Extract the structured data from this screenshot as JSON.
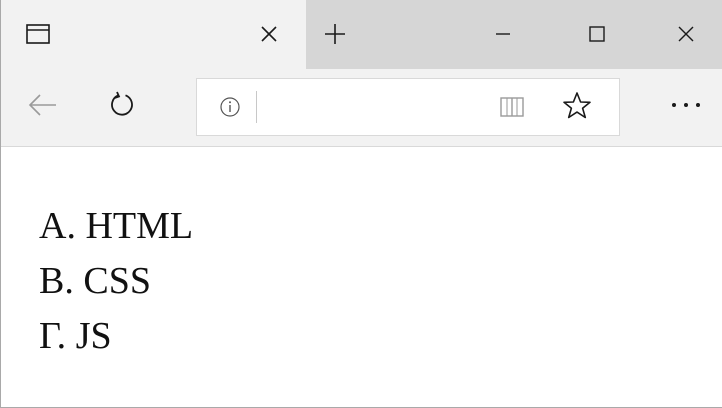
{
  "browser": {
    "tab": {
      "icon": "tab-page-icon",
      "close_icon": "close-icon"
    },
    "new_tab_icon": "plus-icon",
    "window_controls": [
      "minimize-icon",
      "maximize-icon",
      "close-icon"
    ],
    "nav": {
      "back_icon": "arrow-left-icon",
      "refresh_icon": "refresh-icon",
      "site_info_icon": "info-icon",
      "address_value": "",
      "reading_view_icon": "book-icon",
      "favorite_icon": "star-icon",
      "more_icon": "ellipsis-icon"
    },
    "colors": {
      "tabstrip": "#d6d6d6",
      "active_tab": "#f2f2f2",
      "navbar": "#f2f2f2",
      "content": "#ffffff",
      "icon": "#1a1a1a"
    }
  },
  "page": {
    "list": [
      {
        "marker": "А.",
        "text": "HTML"
      },
      {
        "marker": "В.",
        "text": "CSS"
      },
      {
        "marker": "Г.",
        "text": "JS"
      }
    ]
  }
}
